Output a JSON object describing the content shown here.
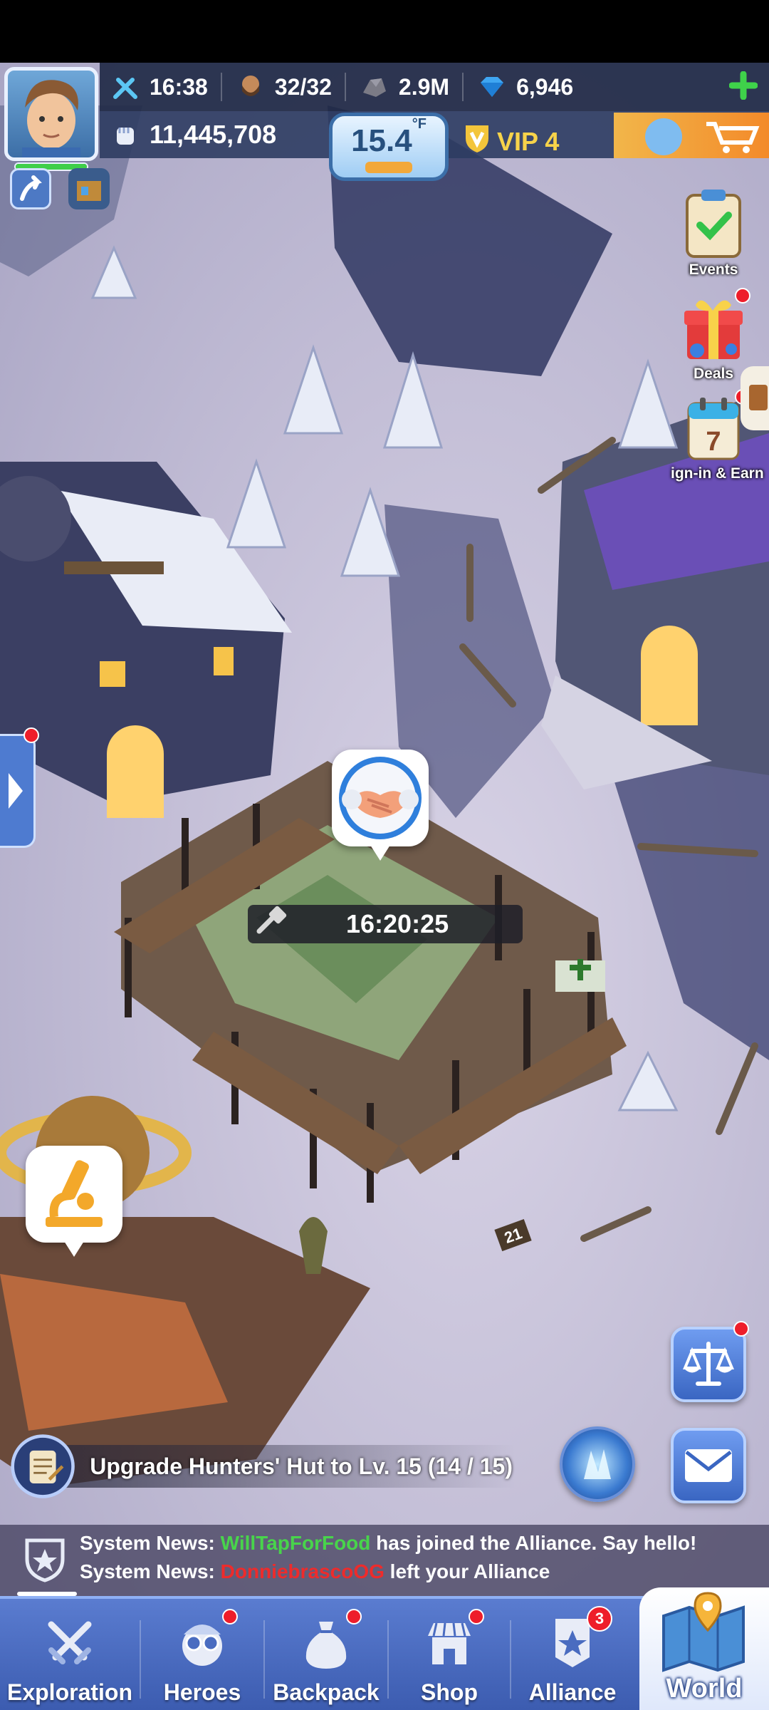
{
  "topbar": {
    "time": "16:38",
    "troops": "32/32",
    "stone": "2.9M",
    "gems": "6,946",
    "power": "11,445,708",
    "temperature_value": "15.4",
    "temperature_unit": "°F",
    "vip": "VIP 4"
  },
  "side": {
    "events_label": "Events",
    "deals_label": "Deals",
    "signin_label": "ign-in & Earn",
    "signin_day": "7"
  },
  "map": {
    "build_timer": "16:20:25",
    "sign_number": "21"
  },
  "quest": {
    "text": "Upgrade Hunters' Hut to Lv. 15 (14 / 15)"
  },
  "news": [
    {
      "prefix": "System News: ",
      "name": "WillTapForFood",
      "suffix": " has joined the Alliance. Say hello!"
    },
    {
      "prefix": "System News: ",
      "name": "DonniebrascoOG",
      "suffix": " left your Alliance"
    }
  ],
  "nav": {
    "exploration": "Exploration",
    "heroes": "Heroes",
    "backpack": "Backpack",
    "shop": "Shop",
    "alliance": "Alliance",
    "alliance_badge": "3",
    "world": "World"
  },
  "colors": {
    "news_join": "#48d44b",
    "news_leave": "#ee2b2b",
    "nav_bg": "#4a6cc0",
    "notify_red": "#ee1d2a"
  }
}
